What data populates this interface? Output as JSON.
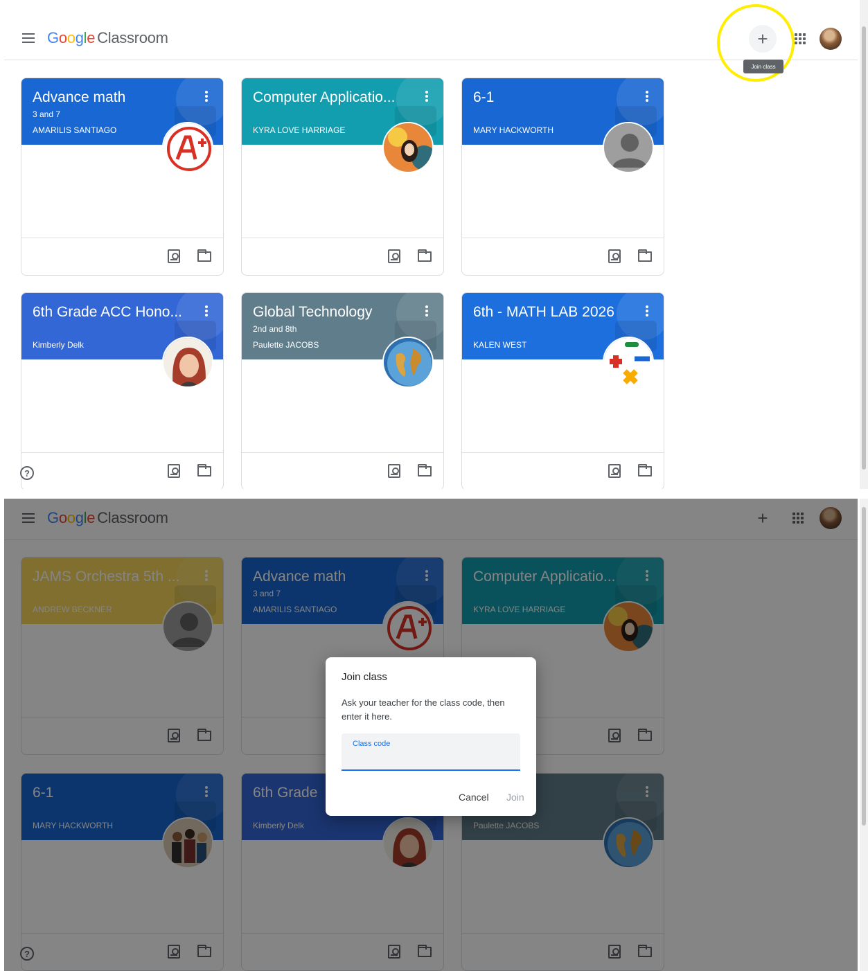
{
  "app": {
    "logo_google": [
      "G",
      "o",
      "o",
      "g",
      "l",
      "e"
    ],
    "logo_product": "Classroom"
  },
  "header": {
    "add_symbol": "+",
    "tooltip": "Join class"
  },
  "help_symbol": "?",
  "top": {
    "classes": [
      {
        "title": "Advance math",
        "section": "3 and 7",
        "teacher": "AMARILIS SANTIAGO",
        "color": "#1967d2",
        "photo": "a-plus"
      },
      {
        "title": "Computer Applicatio...",
        "section": "",
        "teacher": "KYRA LOVE HARRIAGE",
        "color": "#129eaf",
        "photo": "art"
      },
      {
        "title": "6-1",
        "section": "",
        "teacher": "MARY HACKWORTH",
        "color": "#1967d2",
        "photo": "default"
      },
      {
        "title": "6th Grade ACC Hono...",
        "section": "",
        "teacher": "Kimberly Delk",
        "color": "#3367d6",
        "photo": "person"
      },
      {
        "title": "Global Technology",
        "section": "2nd and 8th",
        "teacher": "Paulette JACOBS",
        "color": "#607d8b",
        "photo": "globe"
      },
      {
        "title": "6th - MATH LAB 2026",
        "section": "",
        "teacher": "KALEN WEST",
        "color": "#1e6fde",
        "photo": "math"
      }
    ]
  },
  "bottom": {
    "classes": [
      {
        "title": "JAMS Orchestra 5th ...",
        "section": "",
        "teacher": "ANDREW BECKNER",
        "color": "#f5d55a",
        "photo": "default"
      },
      {
        "title": "Advance math",
        "section": "3 and 7",
        "teacher": "AMARILIS SANTIAGO",
        "color": "#1967d2",
        "photo": "a-plus"
      },
      {
        "title": "Computer Applicatio...",
        "section": "",
        "teacher": "KYRA LOVE HARRIAGE",
        "color": "#129eaf",
        "photo": "art"
      },
      {
        "title": "6-1",
        "section": "",
        "teacher": "MARY HACKWORTH",
        "color": "#1967d2",
        "photo": "group"
      },
      {
        "title": "6th Grade",
        "section": "",
        "teacher": "Kimberly Delk",
        "color": "#3367d6",
        "photo": "person"
      },
      {
        "title": "chnology",
        "section": "",
        "teacher": "Paulette JACOBS",
        "color": "#607d8b",
        "photo": "globe"
      }
    ],
    "dialog": {
      "title": "Join class",
      "description": "Ask your teacher for the class code, then enter it here.",
      "field_label": "Class code",
      "field_value": "",
      "cancel": "Cancel",
      "join": "Join"
    }
  }
}
